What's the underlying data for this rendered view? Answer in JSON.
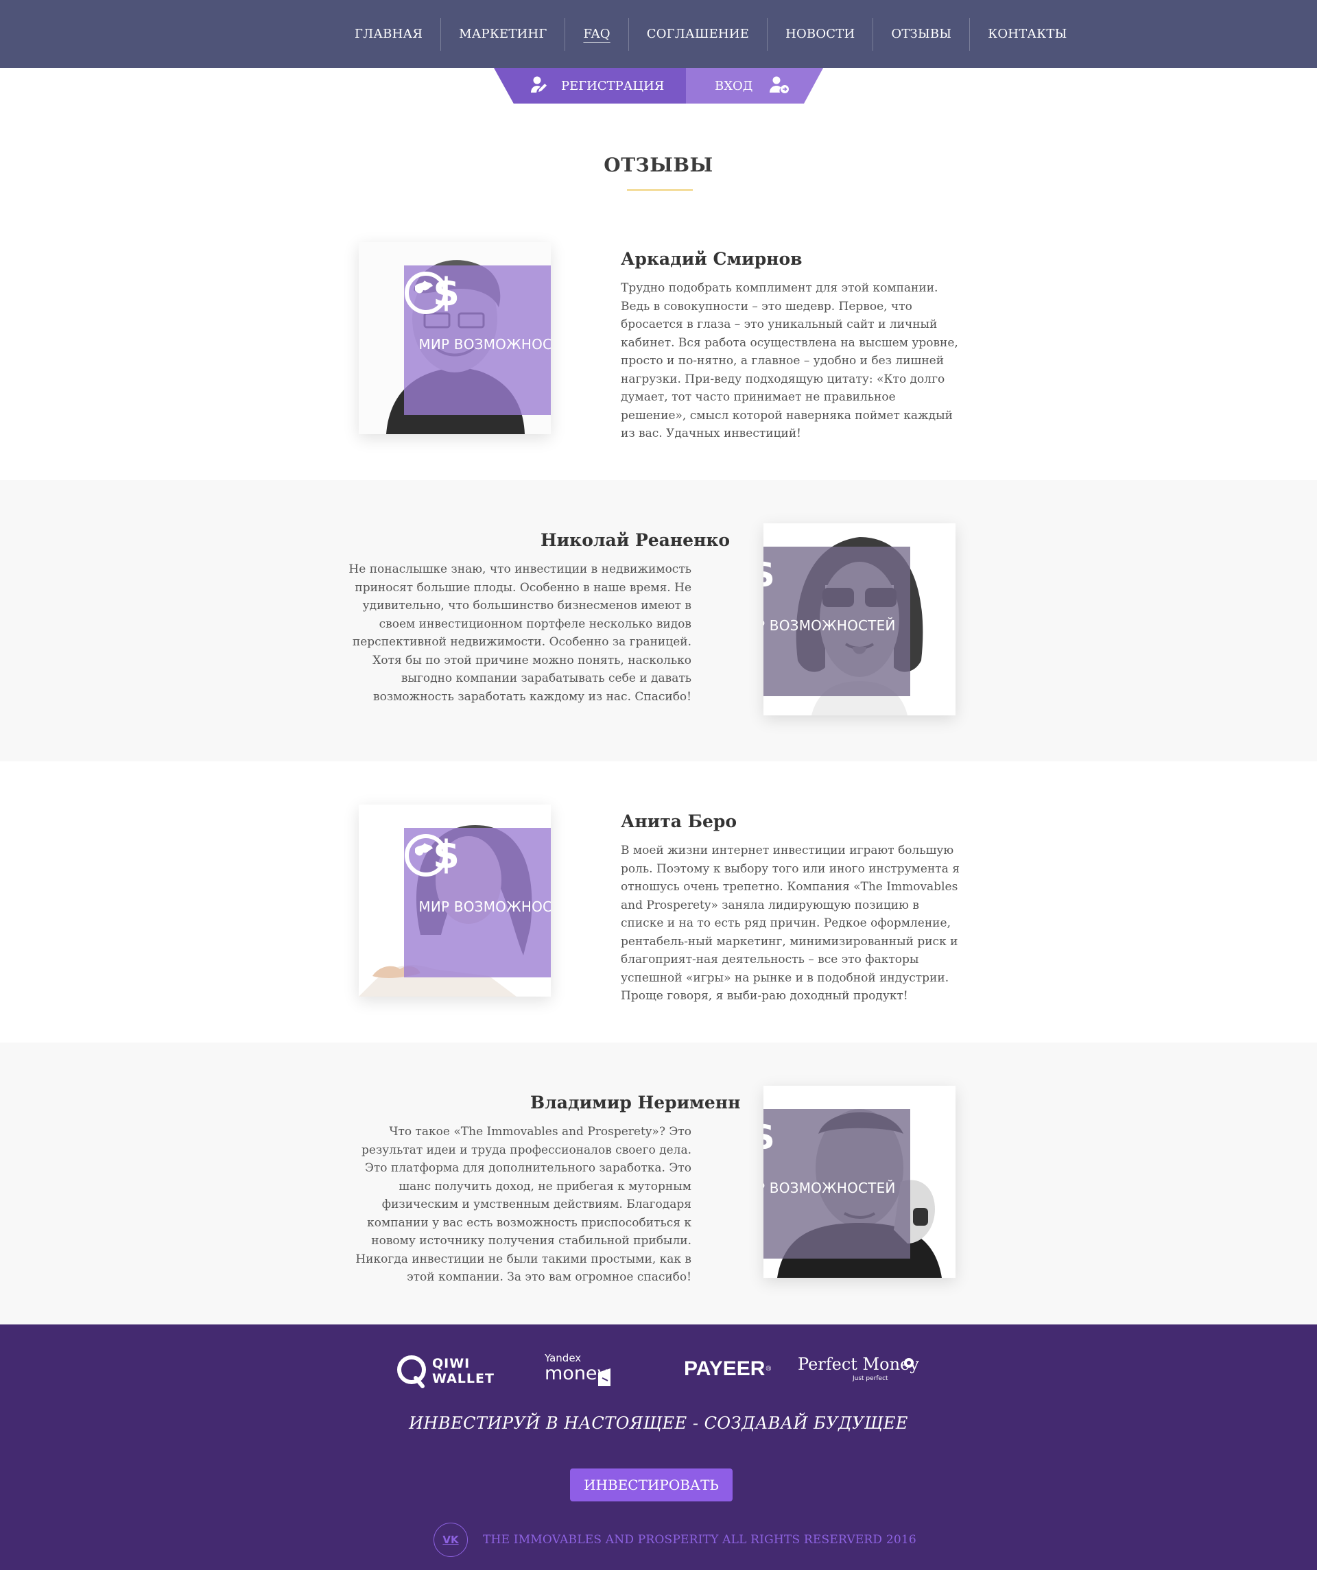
{
  "nav": {
    "items": [
      {
        "label": "ГЛАВНАЯ"
      },
      {
        "label": "МАРКЕТИНГ"
      },
      {
        "label": "FAQ"
      },
      {
        "label": "СОГЛАШЕНИЕ"
      },
      {
        "label": "НОВОСТИ"
      },
      {
        "label": "ОТЗЫВЫ"
      },
      {
        "label": "КОНТАКТЫ"
      }
    ],
    "active": "FAQ"
  },
  "auth": {
    "register_label": "РЕГИСТРАЦИЯ",
    "login_label": "ВХОД"
  },
  "page_title": "ОТЗЫВЫ",
  "brand_overlay": "МИР ВОЗМОЖНОСТЕЙ",
  "reviews": [
    {
      "name": "Аркадий Смирнов",
      "text": "Трудно подобрать комплимент для этой компании. Ведь в совокупности – это шедевр. Первое, что бросается в глаза – это уникальный сайт и личный кабинет. Вся работа осуществлена на высшем уровне, просто и по-нятно, а главное – удобно и без лишней нагрузки. При-веду подходящую цитату: «Кто долго думает, тот часто принимает не правильное решение», смысл которой наверняка поймет каждый из вас. Удачных инвестиций!"
    },
    {
      "name": "Николай Реаненко",
      "text": "Не понаслышке знаю, что инвестиции в недвижимость приносят большие плоды. Особенно в наше время. Не удивительно, что большинство бизнесменов имеют в своем инвестиционном портфеле несколько видов перспективной недвижимости. Особенно за границей. Хотя бы по этой причине можно понять, насколько выгодно компании зарабатывать себе и давать возможность заработать каждому из нас. Спасибо!"
    },
    {
      "name": "Анита Беро",
      "text": "В моей жизни интернет инвестиции играют большую роль. Поэтому к выбору того или иного инструмента я отношусь очень трепетно. Компания «The Immovables and Prosperety» заняла лидирующую позицию в списке и на то есть ряд причин. Редкое оформление, рентабель-ный маркетинг, минимизированный риск и благоприят-ная деятельность – все это факторы успешной «игры» на рынке и в подобной индустрии. Проще говоря, я выби-раю доходный продукт!"
    },
    {
      "name": "Владимир Нерименн",
      "text": "Что такое «The Immovables and Prosperety»? Это результат идеи и труда профессионалов своего дела. Это платформа для дополнительного заработка. Это шанс получить доход, не прибегая к муторным физическим и умственным действиям. Благодаря компании у вас есть возможность приспособиться к новому источнику получения стабильной прибыли. Никогда инвестиции не были такими простыми, как в этой компании. За это вам огромное спасибо!"
    }
  ],
  "footer": {
    "payments": [
      {
        "name": "qiwi",
        "line1": "QIWI",
        "line2": "WALLET"
      },
      {
        "name": "yandex",
        "line1": "Yandex",
        "line2": "money"
      },
      {
        "name": "payeer",
        "line1": "PAYEER",
        "mark": "®"
      },
      {
        "name": "perfectmoney",
        "line1": "Perfect Money",
        "line2": "Just perfect"
      }
    ],
    "slogan": "ИНВЕСТИРУЙ В НАСТОЯЩЕЕ - СОЗДАВАЙ БУДУЩЕЕ",
    "invest_label": "ИНВЕСТИРОВАТЬ",
    "vk_label": "VK",
    "copyright": "THE IMMOVABLES AND PROSPERITY ALL RIGHTS RESERVERD 2016"
  },
  "colors": {
    "nav_bg": "#4f5478",
    "accent": "#7a58c6",
    "footer_bg": "#442a70",
    "button": "#8f5ee6",
    "title_underline": "#f0d27c"
  }
}
